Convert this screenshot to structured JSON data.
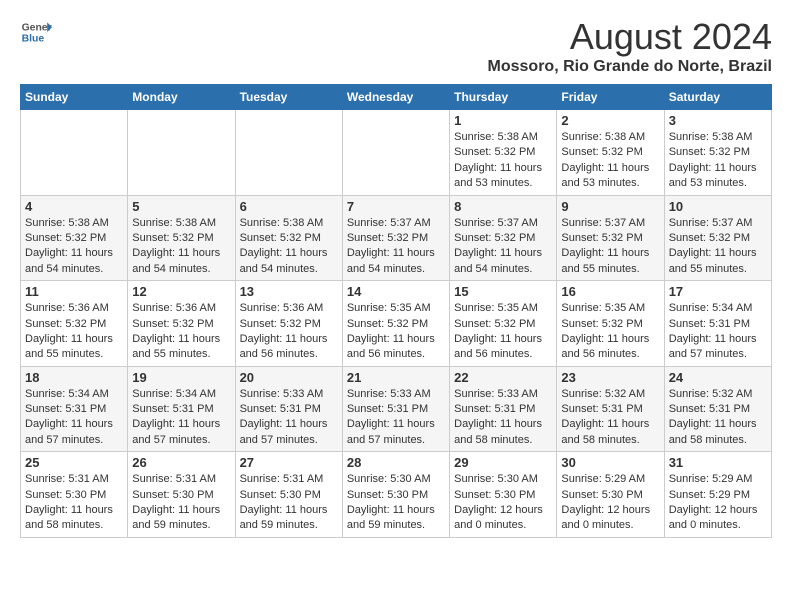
{
  "header": {
    "logo_general": "General",
    "logo_blue": "Blue",
    "main_title": "August 2024",
    "sub_title": "Mossoro, Rio Grande do Norte, Brazil"
  },
  "calendar": {
    "days_of_week": [
      "Sunday",
      "Monday",
      "Tuesday",
      "Wednesday",
      "Thursday",
      "Friday",
      "Saturday"
    ],
    "weeks": [
      [
        {
          "day": "",
          "info": ""
        },
        {
          "day": "",
          "info": ""
        },
        {
          "day": "",
          "info": ""
        },
        {
          "day": "",
          "info": ""
        },
        {
          "day": "1",
          "info": "Sunrise: 5:38 AM\nSunset: 5:32 PM\nDaylight: 11 hours\nand 53 minutes."
        },
        {
          "day": "2",
          "info": "Sunrise: 5:38 AM\nSunset: 5:32 PM\nDaylight: 11 hours\nand 53 minutes."
        },
        {
          "day": "3",
          "info": "Sunrise: 5:38 AM\nSunset: 5:32 PM\nDaylight: 11 hours\nand 53 minutes."
        }
      ],
      [
        {
          "day": "4",
          "info": "Sunrise: 5:38 AM\nSunset: 5:32 PM\nDaylight: 11 hours\nand 54 minutes."
        },
        {
          "day": "5",
          "info": "Sunrise: 5:38 AM\nSunset: 5:32 PM\nDaylight: 11 hours\nand 54 minutes."
        },
        {
          "day": "6",
          "info": "Sunrise: 5:38 AM\nSunset: 5:32 PM\nDaylight: 11 hours\nand 54 minutes."
        },
        {
          "day": "7",
          "info": "Sunrise: 5:37 AM\nSunset: 5:32 PM\nDaylight: 11 hours\nand 54 minutes."
        },
        {
          "day": "8",
          "info": "Sunrise: 5:37 AM\nSunset: 5:32 PM\nDaylight: 11 hours\nand 54 minutes."
        },
        {
          "day": "9",
          "info": "Sunrise: 5:37 AM\nSunset: 5:32 PM\nDaylight: 11 hours\nand 55 minutes."
        },
        {
          "day": "10",
          "info": "Sunrise: 5:37 AM\nSunset: 5:32 PM\nDaylight: 11 hours\nand 55 minutes."
        }
      ],
      [
        {
          "day": "11",
          "info": "Sunrise: 5:36 AM\nSunset: 5:32 PM\nDaylight: 11 hours\nand 55 minutes."
        },
        {
          "day": "12",
          "info": "Sunrise: 5:36 AM\nSunset: 5:32 PM\nDaylight: 11 hours\nand 55 minutes."
        },
        {
          "day": "13",
          "info": "Sunrise: 5:36 AM\nSunset: 5:32 PM\nDaylight: 11 hours\nand 56 minutes."
        },
        {
          "day": "14",
          "info": "Sunrise: 5:35 AM\nSunset: 5:32 PM\nDaylight: 11 hours\nand 56 minutes."
        },
        {
          "day": "15",
          "info": "Sunrise: 5:35 AM\nSunset: 5:32 PM\nDaylight: 11 hours\nand 56 minutes."
        },
        {
          "day": "16",
          "info": "Sunrise: 5:35 AM\nSunset: 5:32 PM\nDaylight: 11 hours\nand 56 minutes."
        },
        {
          "day": "17",
          "info": "Sunrise: 5:34 AM\nSunset: 5:31 PM\nDaylight: 11 hours\nand 57 minutes."
        }
      ],
      [
        {
          "day": "18",
          "info": "Sunrise: 5:34 AM\nSunset: 5:31 PM\nDaylight: 11 hours\nand 57 minutes."
        },
        {
          "day": "19",
          "info": "Sunrise: 5:34 AM\nSunset: 5:31 PM\nDaylight: 11 hours\nand 57 minutes."
        },
        {
          "day": "20",
          "info": "Sunrise: 5:33 AM\nSunset: 5:31 PM\nDaylight: 11 hours\nand 57 minutes."
        },
        {
          "day": "21",
          "info": "Sunrise: 5:33 AM\nSunset: 5:31 PM\nDaylight: 11 hours\nand 57 minutes."
        },
        {
          "day": "22",
          "info": "Sunrise: 5:33 AM\nSunset: 5:31 PM\nDaylight: 11 hours\nand 58 minutes."
        },
        {
          "day": "23",
          "info": "Sunrise: 5:32 AM\nSunset: 5:31 PM\nDaylight: 11 hours\nand 58 minutes."
        },
        {
          "day": "24",
          "info": "Sunrise: 5:32 AM\nSunset: 5:31 PM\nDaylight: 11 hours\nand 58 minutes."
        }
      ],
      [
        {
          "day": "25",
          "info": "Sunrise: 5:31 AM\nSunset: 5:30 PM\nDaylight: 11 hours\nand 58 minutes."
        },
        {
          "day": "26",
          "info": "Sunrise: 5:31 AM\nSunset: 5:30 PM\nDaylight: 11 hours\nand 59 minutes."
        },
        {
          "day": "27",
          "info": "Sunrise: 5:31 AM\nSunset: 5:30 PM\nDaylight: 11 hours\nand 59 minutes."
        },
        {
          "day": "28",
          "info": "Sunrise: 5:30 AM\nSunset: 5:30 PM\nDaylight: 11 hours\nand 59 minutes."
        },
        {
          "day": "29",
          "info": "Sunrise: 5:30 AM\nSunset: 5:30 PM\nDaylight: 12 hours\nand 0 minutes."
        },
        {
          "day": "30",
          "info": "Sunrise: 5:29 AM\nSunset: 5:30 PM\nDaylight: 12 hours\nand 0 minutes."
        },
        {
          "day": "31",
          "info": "Sunrise: 5:29 AM\nSunset: 5:29 PM\nDaylight: 12 hours\nand 0 minutes."
        }
      ]
    ]
  }
}
